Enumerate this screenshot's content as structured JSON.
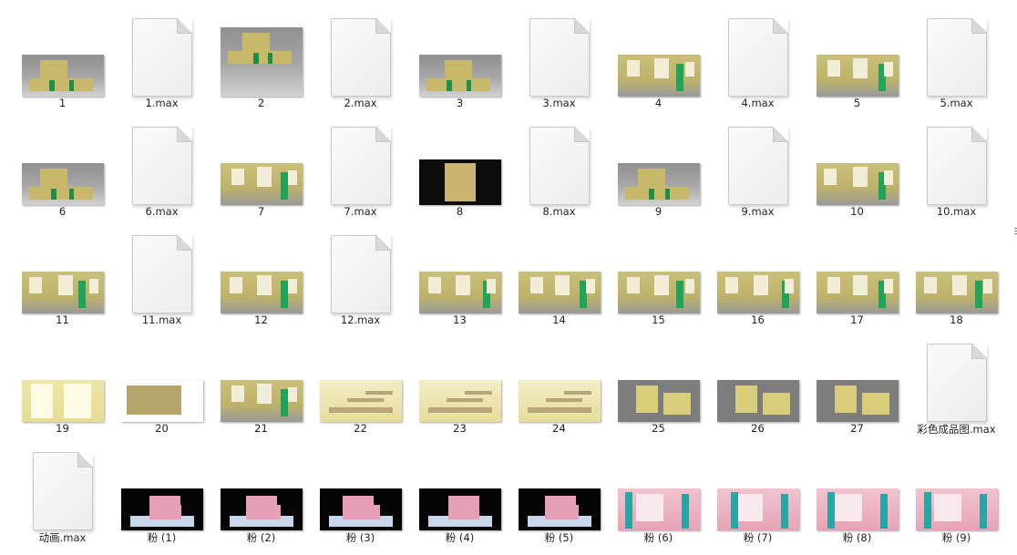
{
  "files": [
    {
      "label": "1",
      "kind": "image",
      "style": "house"
    },
    {
      "label": "1.max",
      "kind": "file"
    },
    {
      "label": "2",
      "kind": "image",
      "style": "house"
    },
    {
      "label": "2.max",
      "kind": "file"
    },
    {
      "label": "3",
      "kind": "image",
      "style": "house"
    },
    {
      "label": "3.max",
      "kind": "file"
    },
    {
      "label": "4",
      "kind": "image",
      "style": "int"
    },
    {
      "label": "4.max",
      "kind": "file"
    },
    {
      "label": "5",
      "kind": "image",
      "style": "int"
    },
    {
      "label": "5.max",
      "kind": "file"
    },
    {
      "label": "6",
      "kind": "image",
      "style": "house"
    },
    {
      "label": "6.max",
      "kind": "file"
    },
    {
      "label": "7",
      "kind": "image",
      "style": "int"
    },
    {
      "label": "7.max",
      "kind": "file"
    },
    {
      "label": "8",
      "kind": "image",
      "style": "dark"
    },
    {
      "label": "8.max",
      "kind": "file"
    },
    {
      "label": "9",
      "kind": "image",
      "style": "house"
    },
    {
      "label": "9.max",
      "kind": "file"
    },
    {
      "label": "10",
      "kind": "image",
      "style": "int"
    },
    {
      "label": "10.max",
      "kind": "file"
    },
    {
      "label": "11",
      "kind": "image",
      "style": "int"
    },
    {
      "label": "11.max",
      "kind": "file"
    },
    {
      "label": "12",
      "kind": "image",
      "style": "int"
    },
    {
      "label": "12.max",
      "kind": "file"
    },
    {
      "label": "13",
      "kind": "image",
      "style": "int"
    },
    {
      "label": "14",
      "kind": "image",
      "style": "int"
    },
    {
      "label": "15",
      "kind": "image",
      "style": "int"
    },
    {
      "label": "16",
      "kind": "image",
      "style": "int"
    },
    {
      "label": "17",
      "kind": "image",
      "style": "int"
    },
    {
      "label": "18",
      "kind": "image",
      "style": "int"
    },
    {
      "label": "19",
      "kind": "image",
      "style": "yel"
    },
    {
      "label": "20",
      "kind": "image",
      "style": "plan"
    },
    {
      "label": "21",
      "kind": "image",
      "style": "int"
    },
    {
      "label": "22",
      "kind": "image",
      "style": "stairs"
    },
    {
      "label": "23",
      "kind": "image",
      "style": "stairs"
    },
    {
      "label": "24",
      "kind": "image",
      "style": "stairs"
    },
    {
      "label": "25",
      "kind": "image",
      "style": "screen"
    },
    {
      "label": "26",
      "kind": "image",
      "style": "screen"
    },
    {
      "label": "27",
      "kind": "image",
      "style": "screen"
    },
    {
      "label": "彩色成品图.max",
      "kind": "file"
    },
    {
      "label": "动画.max",
      "kind": "file"
    },
    {
      "label": "粉 (1)",
      "kind": "image",
      "style": "pink"
    },
    {
      "label": "粉 (2)",
      "kind": "image",
      "style": "pink"
    },
    {
      "label": "粉 (3)",
      "kind": "image",
      "style": "pink"
    },
    {
      "label": "粉 (4)",
      "kind": "image",
      "style": "pink"
    },
    {
      "label": "粉 (5)",
      "kind": "image",
      "style": "pink"
    },
    {
      "label": "粉 (6)",
      "kind": "image",
      "style": "pinkint"
    },
    {
      "label": "粉 (7)",
      "kind": "image",
      "style": "pinkint"
    },
    {
      "label": "粉 (8)",
      "kind": "image",
      "style": "pinkint"
    },
    {
      "label": "粉 (9)",
      "kind": "image",
      "style": "pinkint"
    }
  ]
}
